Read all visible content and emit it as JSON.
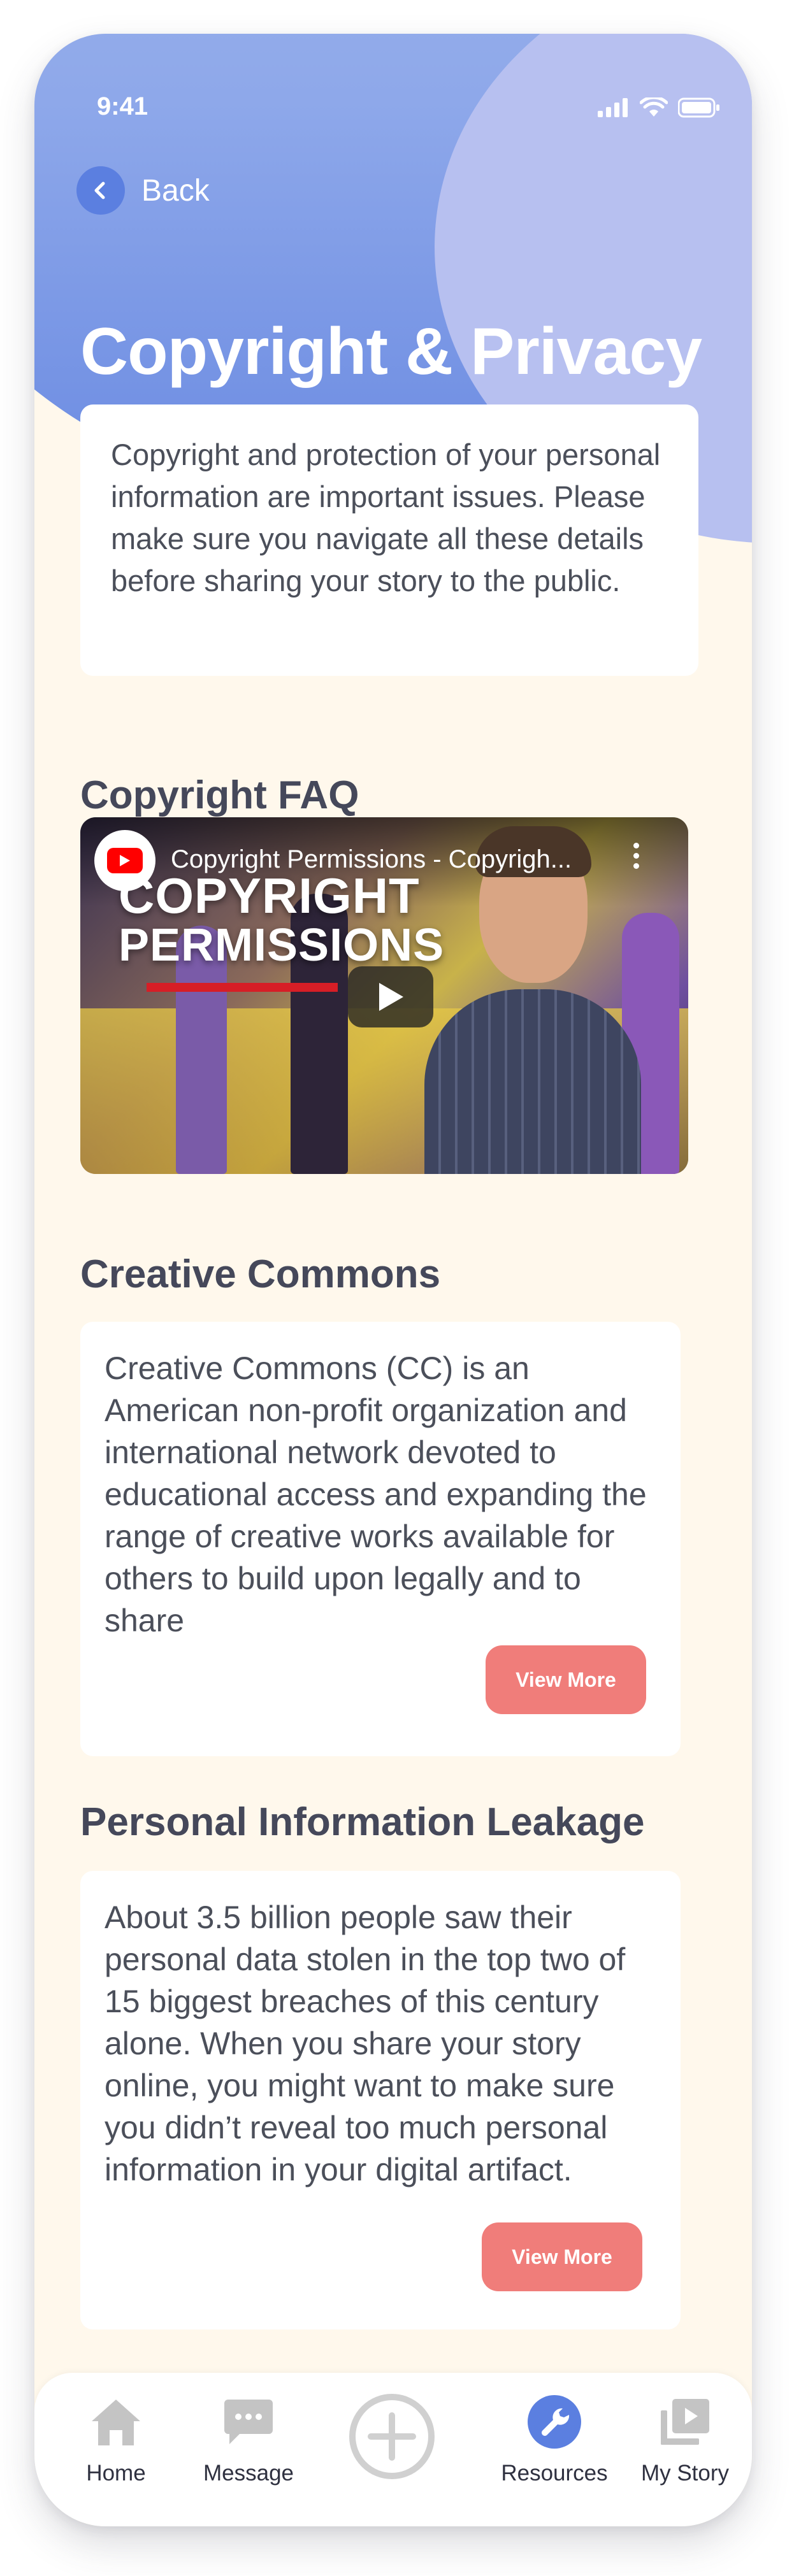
{
  "status": {
    "time": "9:41"
  },
  "nav": {
    "back_label": "Back"
  },
  "page": {
    "title": "Copyright & Privacy"
  },
  "intro": {
    "text": "Copyright and protection of your personal information are important issues. Please make sure you navigate all these details before sharing your story to the public."
  },
  "sections": {
    "faq": {
      "title": "Copyright FAQ",
      "video": {
        "title": "Copyright Permissions - Copyrigh...",
        "thumb_line1": "COPYRIGHT",
        "thumb_line2": "PERMISSIONS"
      }
    },
    "cc": {
      "title": "Creative Commons",
      "text": "Creative Commons (CC) is an American non-profit organization and international network devoted to educational access and expanding the range of creative works available for others to build upon legally and to share",
      "button": "View More"
    },
    "pil": {
      "title": "Personal Information Leakage",
      "text": "About 3.5 billion people saw their personal data stolen in the top two of 15 biggest breaches of this century alone.  When you share your story online, you might want to make sure you didn’t reveal too much personal information in your digital artifact.",
      "button": "View More"
    }
  },
  "tabbar": {
    "items": [
      {
        "label": "Home",
        "icon": "home-icon",
        "active": false
      },
      {
        "label": "Message",
        "icon": "message-icon",
        "active": false
      },
      {
        "label": "",
        "icon": "add-icon",
        "active": false
      },
      {
        "label": "Resources",
        "icon": "wrench-icon",
        "active": true
      },
      {
        "label": "My Story",
        "icon": "video-library-icon",
        "active": false
      }
    ]
  },
  "colors": {
    "header_start": "#a8bce8",
    "header_end": "#6b8be2",
    "header_circle": "#b7c0f0",
    "background": "#fff8ec",
    "accent": "#5b7fe0",
    "button": "#f07d7a",
    "text": "#4b4f5a",
    "icon_inactive": "#c4c4c4"
  }
}
